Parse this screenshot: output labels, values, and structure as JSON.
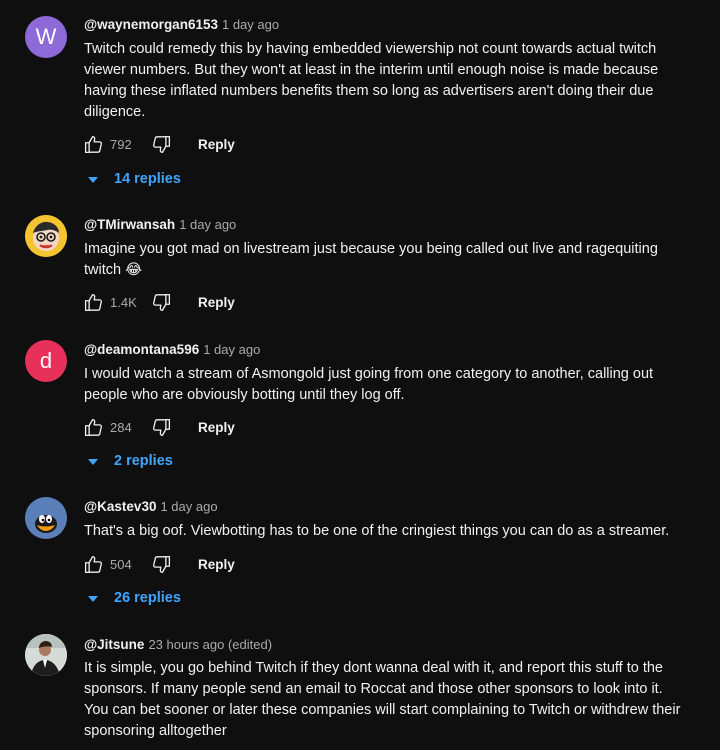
{
  "colors": {
    "background": "#0f0f0f",
    "text_primary": "#f1f1f1",
    "text_secondary": "#aaaaaa",
    "link_blue": "#3ea6ff",
    "avatar_w": "#8e6ad8",
    "avatar_d": "#e8315a",
    "avatar_tmirwansah": "#f4c430",
    "avatar_kastev": "#4a6a9c"
  },
  "comments": [
    {
      "avatar_letter": "W",
      "avatar_icon": "letter-avatar",
      "handle": "@waynemorgan6153",
      "time": "1 day ago",
      "lines": [
        "Twitch could remedy this by having embedded viewership not count towards actual twitch",
        "viewer numbers. But they won't at least in the interim until enough noise is made because",
        "having these inflated numbers benefits them so long as advertisers aren't doing their due",
        "diligence."
      ],
      "likes": "792",
      "reply_label": "Reply",
      "replies_label": "14 replies"
    },
    {
      "avatar_icon": "cartoon-face-avatar",
      "handle": "@TMirwansah",
      "time": "1 day ago",
      "lines": [
        "Imagine you got mad on livestream just because you being called out live and ragequiting",
        "twitch 😂"
      ],
      "likes": "1.4K",
      "reply_label": "Reply"
    },
    {
      "avatar_letter": "d",
      "avatar_icon": "letter-avatar",
      "handle": "@deamontana596",
      "time": "1 day ago",
      "lines": [
        "I would watch a stream of Asmongold just going from one category to another, calling out",
        "people who are obviously botting until they log off."
      ],
      "likes": "284",
      "reply_label": "Reply",
      "replies_label": "2 replies"
    },
    {
      "avatar_icon": "duck-avatar",
      "handle": "@Kastev30",
      "time": "1 day ago",
      "lines": [
        "That's a big oof.  Viewbotting has to be one of the cringiest things you can do as a streamer."
      ],
      "likes": "504",
      "reply_label": "Reply",
      "replies_label": "26 replies"
    },
    {
      "avatar_icon": "person-photo-avatar",
      "handle": "@Jitsune",
      "time": "23 hours ago (edited)",
      "lines": [
        "It is simple, you go behind Twitch if they dont wanna deal with it, and report this stuff to the",
        "sponsors. If many people send an email to Roccat and those other sponsors to look into it.",
        "You can bet sooner or later these companies will start complaining to Twitch or withdrew their",
        "sponsoring alltogether"
      ]
    }
  ]
}
